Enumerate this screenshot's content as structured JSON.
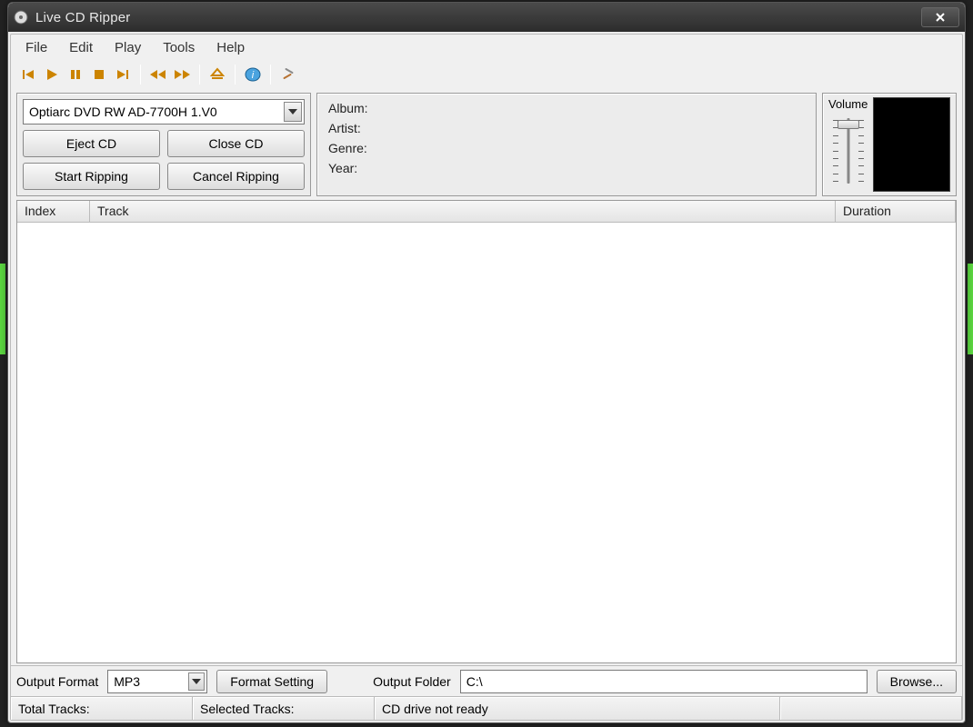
{
  "window": {
    "title": "Live CD Ripper"
  },
  "menu": {
    "file": "File",
    "edit": "Edit",
    "play": "Play",
    "tools": "Tools",
    "help": "Help"
  },
  "toolbar_icons": {
    "prev": "previous-track-icon",
    "play": "play-icon",
    "pause": "pause-icon",
    "stop": "stop-icon",
    "next": "next-track-icon",
    "rewind": "rewind-icon",
    "ff": "fast-forward-icon",
    "eject": "eject-icon",
    "info": "info-icon",
    "settings": "settings-icon"
  },
  "drive": {
    "selected": "Optiarc DVD RW AD-7700H 1.V0",
    "buttons": {
      "eject": "Eject CD",
      "close": "Close CD",
      "start": "Start Ripping",
      "cancel": "Cancel Ripping"
    }
  },
  "info": {
    "album_label": "Album:",
    "artist_label": "Artist:",
    "genre_label": "Genre:",
    "year_label": "Year:"
  },
  "volume": {
    "label": "Volume"
  },
  "table": {
    "headers": {
      "index": "Index",
      "track": "Track",
      "duration": "Duration"
    },
    "rows": []
  },
  "output": {
    "format_label": "Output Format",
    "format_value": "MP3",
    "format_setting_btn": "Format Setting",
    "folder_label": "Output Folder",
    "folder_value": "C:\\",
    "browse_btn": "Browse..."
  },
  "status": {
    "total_tracks": "Total Tracks:",
    "selected_tracks": "Selected Tracks:",
    "cd_status": "CD drive not ready"
  }
}
